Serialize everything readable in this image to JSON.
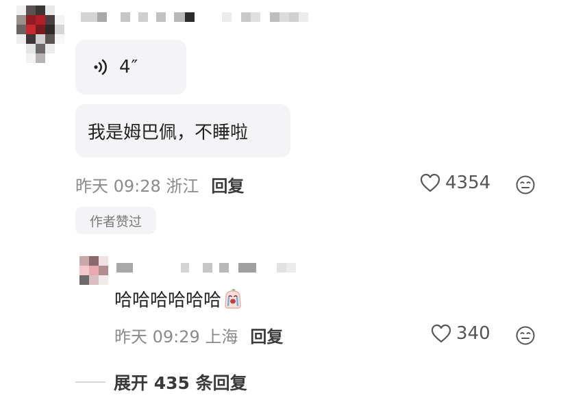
{
  "comment": {
    "voice": {
      "icon": "voice-wave-icon",
      "duration": "4″"
    },
    "text": "我是姆巴佩，不睡啦",
    "time": "昨天 09:28 浙江",
    "reply_label": "回复",
    "like_count": "4354",
    "author_badge": "作者赞过"
  },
  "reply": {
    "text": "哈哈哈哈哈哈",
    "sticker": "crying-laughing-sticker",
    "time": "昨天 09:29 上海",
    "reply_label": "回复",
    "like_count": "340"
  },
  "expand_label": "展开 435 条回复",
  "colors": {
    "bubble_bg": "#f4f4f6",
    "meta_gray": "#8a8a8a",
    "text_dark": "#222222"
  }
}
